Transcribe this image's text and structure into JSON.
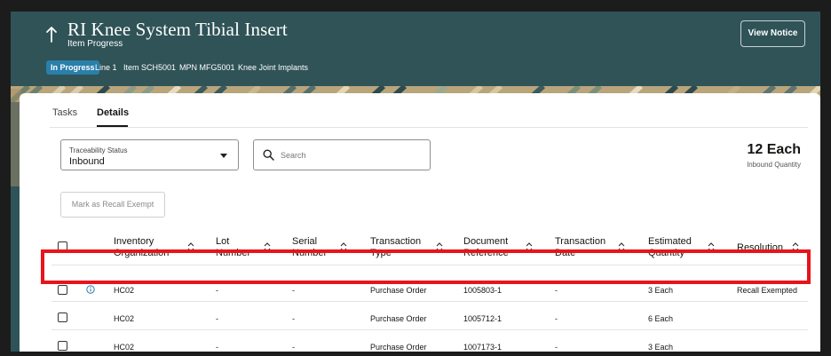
{
  "header": {
    "title": "RI Knee System Tibial Insert",
    "subtitle": "Item Progress",
    "status_badge": "In Progress",
    "meta": [
      "Line 1",
      "Item SCH5001",
      "MPN MFG5001",
      "Knee Joint Implants"
    ],
    "view_notice_label": "View Notice"
  },
  "tabs": [
    {
      "label": "Tasks",
      "active": false
    },
    {
      "label": "Details",
      "active": true
    }
  ],
  "filter": {
    "label": "Traceability Status",
    "value": "Inbound"
  },
  "search": {
    "placeholder": "Search"
  },
  "quantity": {
    "value": "12 Each",
    "label": "Inbound Quantity"
  },
  "actions": {
    "recall_exempt_label": "Mark as Recall Exempt"
  },
  "table": {
    "columns": [
      {
        "line1": "Inventory",
        "line2": "Organization"
      },
      {
        "line1": "Lot",
        "line2": "Number"
      },
      {
        "line1": "Serial",
        "line2": "Number"
      },
      {
        "line1": "Transaction",
        "line2": "Type"
      },
      {
        "line1": "Document",
        "line2": "Reference"
      },
      {
        "line1": "Transaction",
        "line2": "Date"
      },
      {
        "line1": "Estimated",
        "line2": "Quantity"
      },
      {
        "line1": "Resolution",
        "line2": ""
      }
    ],
    "rows": [
      {
        "org": "HC02",
        "lot": "-",
        "serial": "-",
        "type": "Purchase Order",
        "doc": "1005803-1",
        "date": "-",
        "qty": "3 Each",
        "resolution": "Recall Exempted"
      },
      {
        "org": "HC02",
        "lot": "-",
        "serial": "-",
        "type": "Purchase Order",
        "doc": "1005712-1",
        "date": "-",
        "qty": "6 Each",
        "resolution": ""
      },
      {
        "org": "HC02",
        "lot": "-",
        "serial": "-",
        "type": "Purchase Order",
        "doc": "1007173-1",
        "date": "-",
        "qty": "3 Each",
        "resolution": ""
      }
    ]
  },
  "colors": {
    "header_bg": "#2f5357",
    "badge": "#2a7fab",
    "highlight": "#e8141b"
  }
}
